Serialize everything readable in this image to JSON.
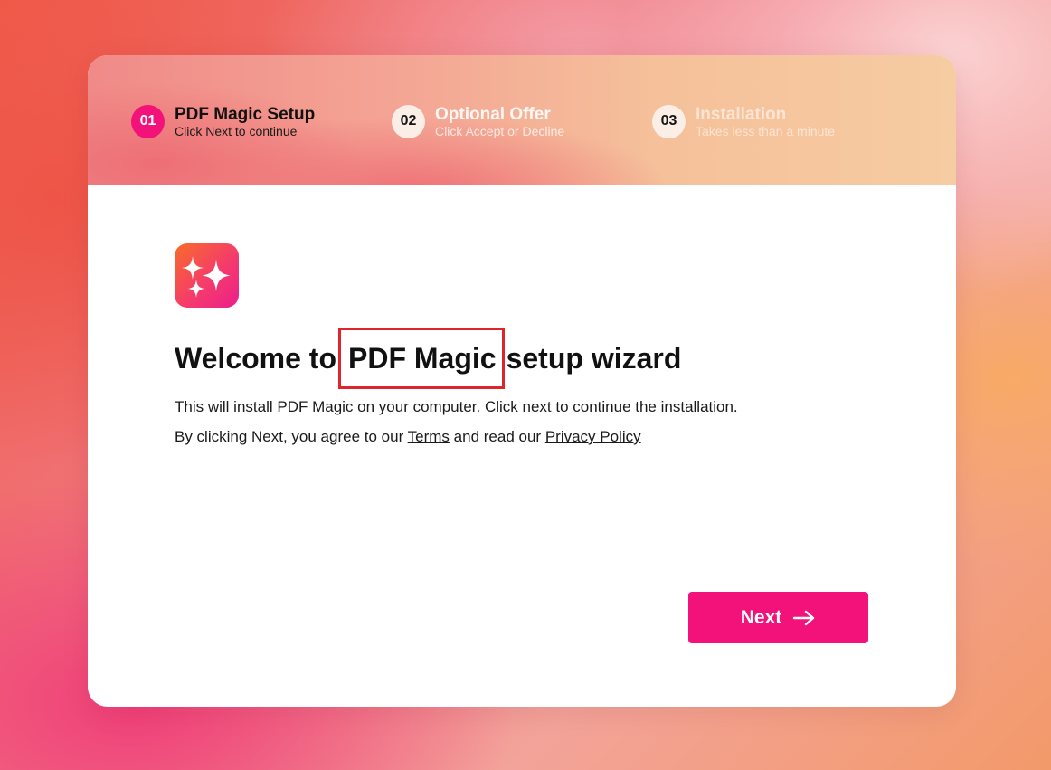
{
  "steps": [
    {
      "number": "01",
      "title": "PDF Magic Setup",
      "subtitle": "Click Next to continue"
    },
    {
      "number": "02",
      "title": "Optional Offer",
      "subtitle": "Click Accept or Decline"
    },
    {
      "number": "03",
      "title": "Installation",
      "subtitle": "Takes less than a minute"
    }
  ],
  "main": {
    "icon": "sparkles-icon",
    "title_prefix": "Welcome to",
    "title_highlight": "PDF Magic",
    "title_suffix": "setup wizard",
    "description": "This will install PDF Magic on your computer. Click next to continue the installation.",
    "agree_prefix": "By clicking Next, you agree to our",
    "terms_link": "Terms",
    "agree_middle": "and read our",
    "privacy_link": "Privacy Policy"
  },
  "next_button": {
    "label": "Next",
    "icon": "arrow-right-icon"
  },
  "colors": {
    "accent": "#f2127a",
    "highlight_box": "#e0242c"
  }
}
